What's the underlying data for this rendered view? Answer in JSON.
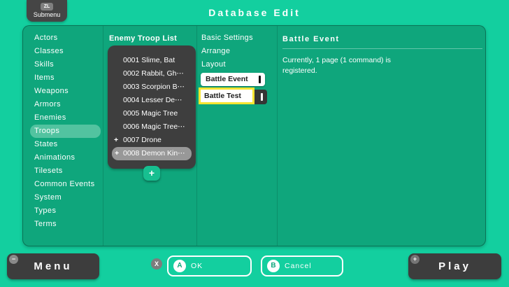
{
  "window": {
    "title": "Database Edit"
  },
  "topbar": {
    "submenu_badge": "ZL",
    "submenu_label": "Submenu"
  },
  "sidebar": {
    "items": [
      "Actors",
      "Classes",
      "Skills",
      "Items",
      "Weapons",
      "Armors",
      "Enemies",
      "Troops",
      "States",
      "Animations",
      "Tilesets",
      "Common Events",
      "System",
      "Types",
      "Terms"
    ],
    "selected": "Troops"
  },
  "troop_list": {
    "title": "Enemy Troop List",
    "items": [
      {
        "prefix": "",
        "label": "0001 Slime, Bat"
      },
      {
        "prefix": "",
        "label": "0002 Rabbit, Gh⋯"
      },
      {
        "prefix": "",
        "label": "0003 Scorpion B⋯"
      },
      {
        "prefix": "",
        "label": "0004 Lesser De⋯"
      },
      {
        "prefix": "",
        "label": "0005 Magic Tree"
      },
      {
        "prefix": "",
        "label": "0006 Magic Tree⋯"
      },
      {
        "prefix": "+",
        "label": "0007 Drone"
      },
      {
        "prefix": "+",
        "label": "0008 Demon Kin⋯"
      }
    ],
    "selected": "0008 Demon Kin⋯",
    "add_button_label": "+"
  },
  "settings_menu": {
    "items": [
      "Basic Settings",
      "Arrange",
      "Layout"
    ],
    "battle_event_button": "Battle Event",
    "battle_test_button": "Battle Test",
    "highlighted": "Battle Test"
  },
  "detail_panel": {
    "title": "Battle Event",
    "body_line1": "Currently, 1 page (1 command) is",
    "body_line2": "registered."
  },
  "bottom_bar": {
    "menu_badge": "−",
    "menu_label": "Menu",
    "x_button": "X",
    "ok_badge": "A",
    "ok_label": "OK",
    "cancel_badge": "B",
    "cancel_label": "Cancel",
    "play_badge": "+",
    "play_label": "Play"
  },
  "colors": {
    "background": "#13cf9f",
    "panel": "#0fa67c",
    "dark_button": "#3d3d3d",
    "highlight_yellow": "#f9e532",
    "selected_row_gray": "#989898",
    "selected_nav_green": "#52c3a0",
    "add_button_green": "#17bf90"
  }
}
